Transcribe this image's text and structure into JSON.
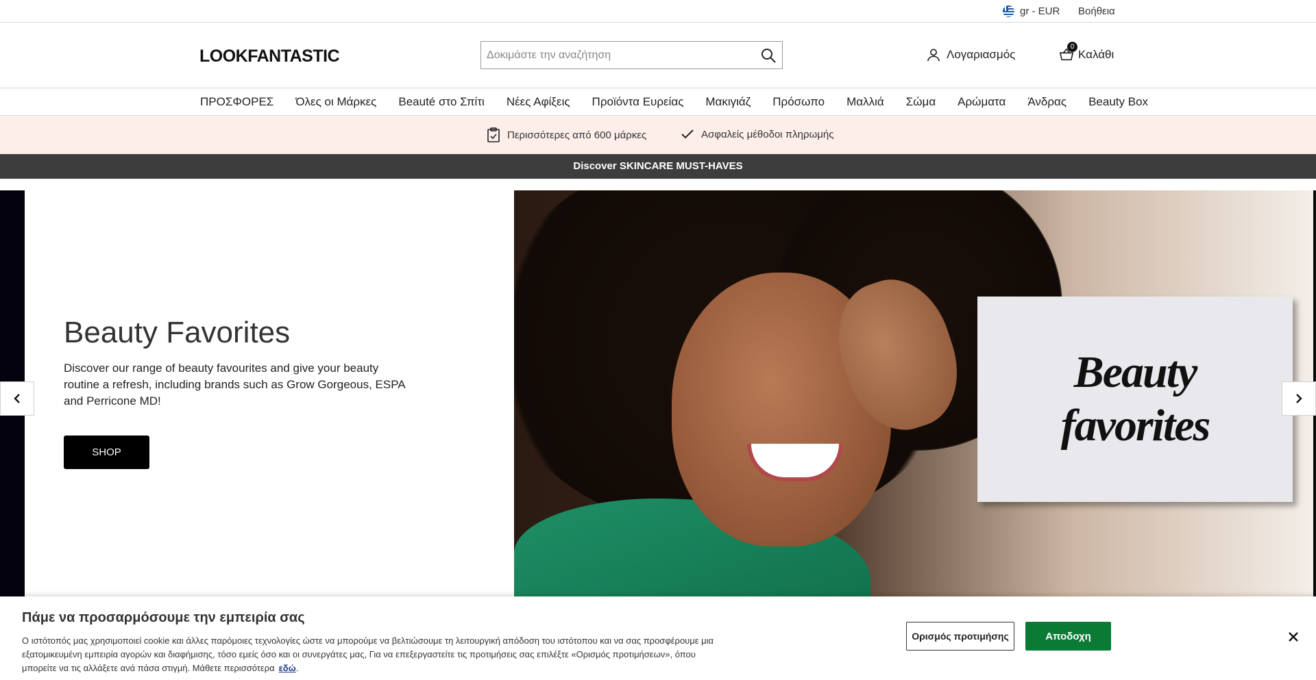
{
  "utility": {
    "locale": "gr - EUR",
    "help": "Βοήθεια"
  },
  "header": {
    "logo": "LOOKFANTASTIC",
    "search_placeholder": "Δοκιμάστε την αναζήτηση",
    "account_label": "Λογαριασμός",
    "cart_label": "Καλάθι",
    "cart_count": "0"
  },
  "nav": {
    "items": [
      "ΠΡΟΣΦΟΡΕΣ",
      "Όλες οι Μάρκες",
      "Beauté στο Σπίτι",
      "Νέες Αφίξεις",
      "Προϊόντα Ευρείας",
      "Μακιγιάζ",
      "Πρόσωπο",
      "Μαλλιά",
      "Σώμα",
      "Αρώματα",
      "Άνδρας",
      "Beauty Box"
    ]
  },
  "usp": {
    "brands": "Περισσότερες από 600 μάρκες",
    "payment": "Ασφαλείς μέθοδοι πληρωμής"
  },
  "promo": {
    "text": "Discover SKINCARE MUST-HAVES"
  },
  "hero": {
    "title": "Beauty Favorites",
    "description": "Discover our range of beauty favourites and give your beauty routine a refresh, including brands such as Grow Gorgeous, ESPA and Perricone MD!",
    "cta": "SHOP",
    "card_line1": "Beauty",
    "card_line2": "favorites"
  },
  "cookie": {
    "title": "Πάμε να προσαρμόσουμε την εμπειρία σας",
    "text": "Ο ιστότοπός μας χρησιμοποιεί cookie και άλλες παρόμοιες τεχνολογίες ώστε να μπορούμε να βελτιώσουμε τη λειτουργική απόδοση του ιστότοπου και να σας προσφέρουμε μια εξατομικευμένη εμπειρία αγορών και διαφήμισης, τόσο εμείς όσο και οι συνεργάτες μας, Για να επεξεργαστείτε τις προτιμήσεις σας επιλέξτε «Ορισμός προτιμήσεων», όπου μπορείτε να τις αλλάξετε ανά πάσα στιγμή. Μάθετε περισσότερα",
    "link": "εδώ",
    "preferences": "Ορισμός προτιμήσης",
    "accept": "Αποδοχη"
  },
  "colors": {
    "usp_bg": "#fdeeea",
    "promo_bg": "#3d3d3d",
    "accept_bg": "#0a7a34"
  }
}
